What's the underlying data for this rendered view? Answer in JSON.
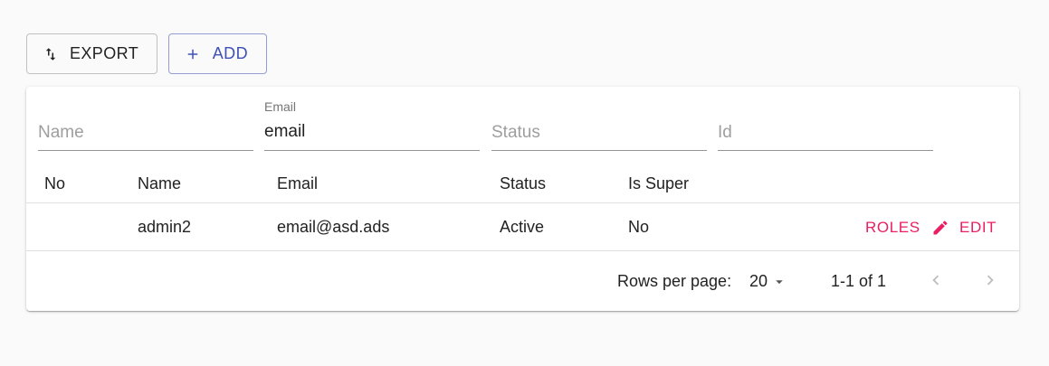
{
  "toolbar": {
    "export_label": "EXPORT",
    "add_label": "ADD"
  },
  "filters": {
    "name": {
      "placeholder": "Name"
    },
    "email": {
      "label": "Email",
      "value": "email"
    },
    "status": {
      "placeholder": "Status"
    },
    "id": {
      "placeholder": "Id"
    }
  },
  "table": {
    "columns": [
      "No",
      "Name",
      "Email",
      "Status",
      "Is Super"
    ],
    "rows": [
      {
        "no": "",
        "name": "admin2",
        "email": "email@asd.ads",
        "status": "Active",
        "is_super": "No"
      }
    ],
    "row_actions": {
      "roles_label": "ROLES",
      "edit_label": "EDIT"
    }
  },
  "pagination": {
    "rows_per_page_label": "Rows per page:",
    "rows_per_page": "20",
    "range": "1-1 of 1"
  },
  "colors": {
    "primary": "#3f51b5",
    "secondary": "#e91e63",
    "background": "#fafafa"
  },
  "icons": {
    "export": "swap-vertical-icon",
    "add": "plus-icon",
    "edit": "pencil-icon",
    "dropdown": "arrow-drop-down-icon",
    "prev": "chevron-left-icon",
    "next": "chevron-right-icon"
  }
}
